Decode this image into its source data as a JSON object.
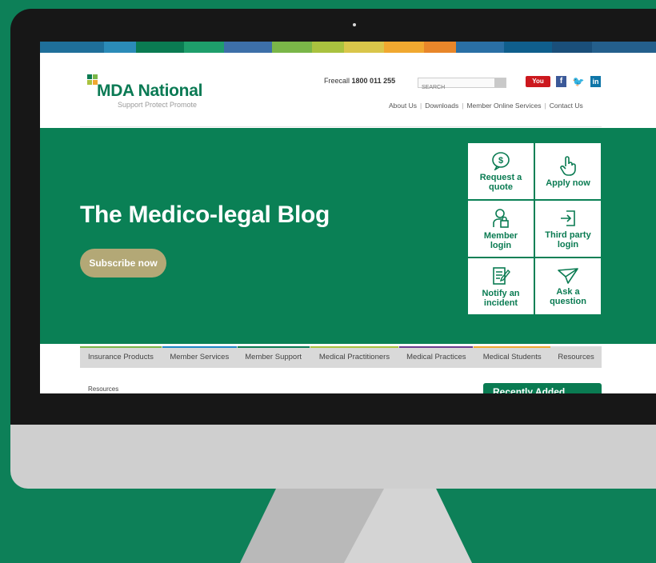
{
  "header": {
    "logo_name": "MDA National",
    "tagline": "Support Protect Promote",
    "freecall_label": "Freecall",
    "freecall_number": "1800 011 255",
    "search_placeholder": "SEARCH",
    "social": {
      "youtube": "You Tube",
      "facebook": "f",
      "twitter": "🐦",
      "linkedin": "in"
    },
    "links": [
      "About Us",
      "Downloads",
      "Member Online Services",
      "Contact Us"
    ]
  },
  "hero": {
    "title": "The Medico-legal Blog",
    "subscribe_label": "Subscribe now",
    "tiles": [
      {
        "line1": "Request a",
        "line2": "quote",
        "icon": "dollar-icon"
      },
      {
        "line1": "Apply now",
        "line2": "",
        "icon": "pointer-hand-icon"
      },
      {
        "line1": "Member",
        "line2": "login",
        "icon": "member-lock-icon"
      },
      {
        "line1": "Third party",
        "line2": "login",
        "icon": "login-arrow-icon"
      },
      {
        "line1": "Notify an",
        "line2": "incident",
        "icon": "clipboard-pen-icon"
      },
      {
        "line1": "Ask a",
        "line2": "question",
        "icon": "paper-plane-icon"
      }
    ]
  },
  "nav": {
    "items": [
      {
        "label": "Insurance Products",
        "color": "#7ab648"
      },
      {
        "label": "Member Services",
        "color": "#1e88c7"
      },
      {
        "label": "Member Support",
        "color": "#0a7b52"
      },
      {
        "label": "Medical Practitioners",
        "color": "#a9c23f"
      },
      {
        "label": "Medical Practices",
        "color": "#6a3d8f"
      },
      {
        "label": "Medical Students",
        "color": "#f0a830"
      },
      {
        "label": "Resources",
        "color": "#d9d9d9"
      }
    ]
  },
  "content": {
    "breadcrumb": "Resources",
    "sidebar_title": "Recently Added"
  },
  "colors": {
    "background": "#0d8058",
    "brand_green": "#0a7b52",
    "subscribe_gold": "#b3a876"
  }
}
